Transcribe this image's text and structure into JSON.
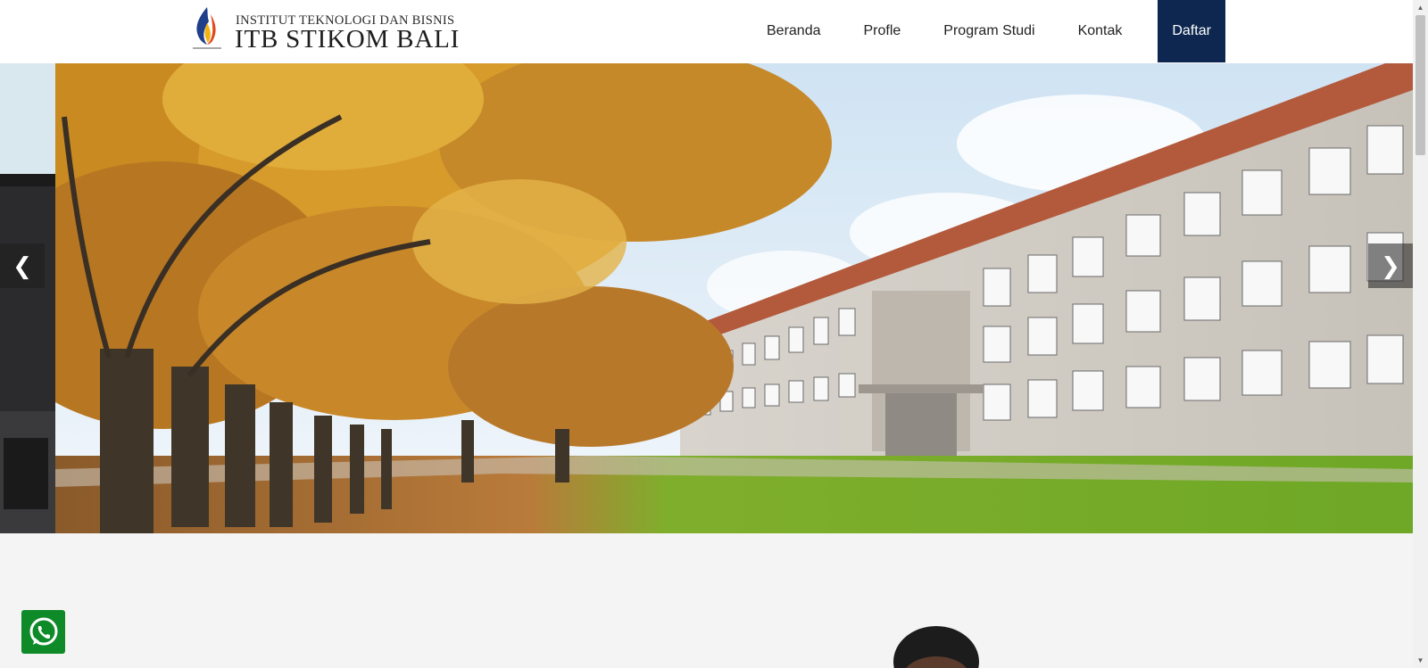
{
  "brand": {
    "subtitle": "INSTITUT TEKNOLOGI DAN BISNIS",
    "name": "ITB STIKOM BALI"
  },
  "nav": {
    "items": [
      "Beranda",
      "Profle",
      "Program Studi",
      "Kontak"
    ],
    "cta": "Daftar",
    "cta_color": "#0d2750"
  },
  "slider": {
    "prev_arrow": "❮",
    "next_arrow": "❯"
  },
  "whatsapp": {
    "icon": "whatsapp-icon",
    "color": "#0e8a29"
  }
}
